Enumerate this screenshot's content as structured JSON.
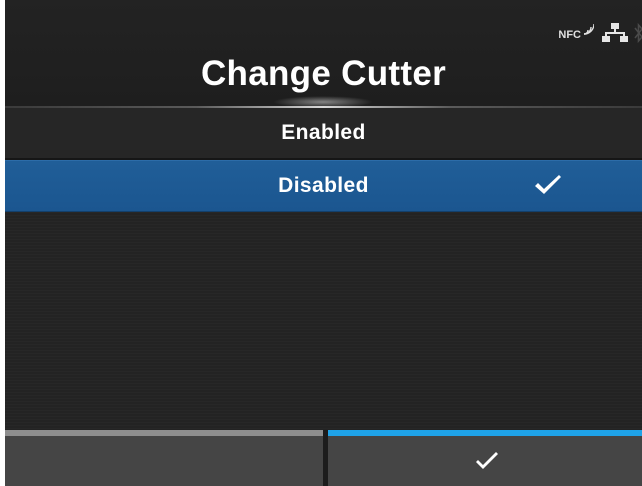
{
  "header": {
    "title": "Change Cutter",
    "status_icons": [
      {
        "name": "nfc-icon",
        "label": "NFC"
      },
      {
        "name": "network-icon"
      },
      {
        "name": "bluetooth-icon"
      }
    ]
  },
  "options": [
    {
      "label": "Enabled",
      "selected": false
    },
    {
      "label": "Disabled",
      "selected": true
    }
  ],
  "footer": {
    "left_button": {
      "label": "",
      "icon": "none"
    },
    "right_button": {
      "label": "",
      "icon": "check-icon"
    }
  },
  "colors": {
    "background": "#232323",
    "selected_row": "#1d5a94",
    "footer_button": "#454545",
    "footer_left_accent": "#8e8e8e",
    "footer_right_accent": "#1fa3e8"
  }
}
